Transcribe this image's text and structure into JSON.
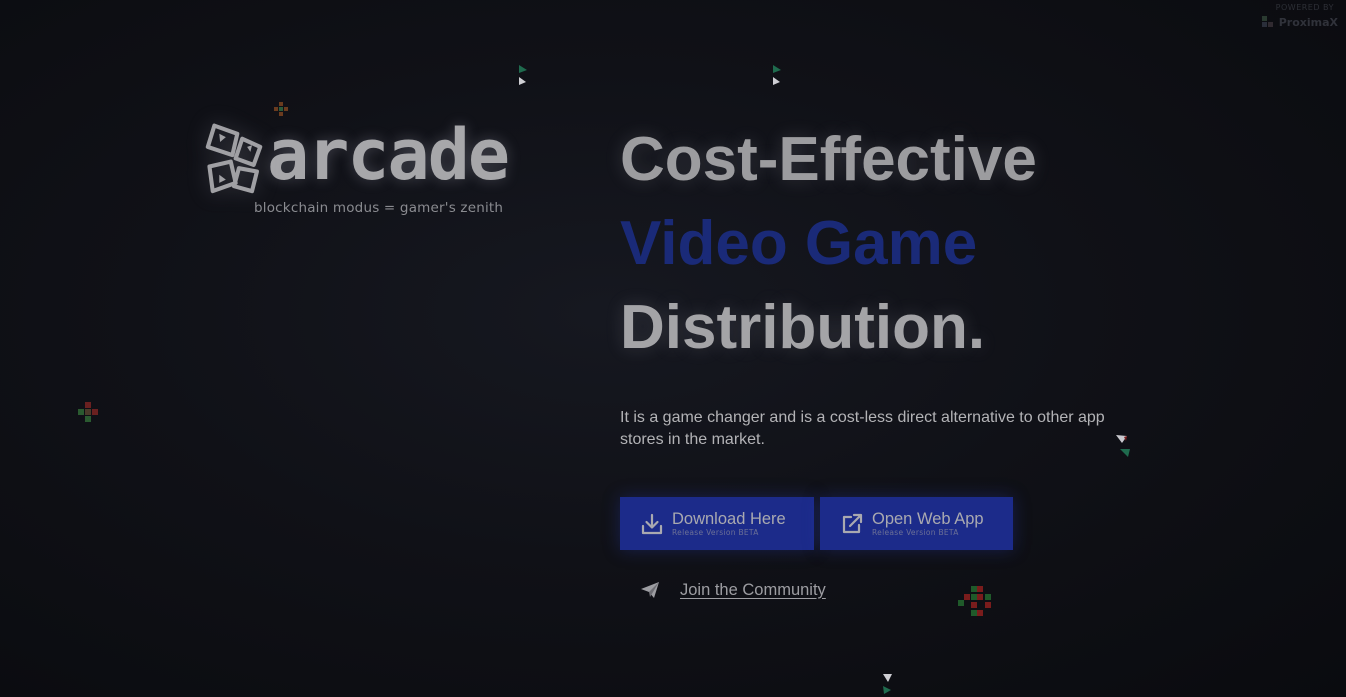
{
  "powered_by": {
    "label": "POWERED BY",
    "brand": "ProximaX"
  },
  "logo": {
    "wordmark": "arcade",
    "tagline": "blockchain modus = gamer's zenith"
  },
  "hero": {
    "line1": "Cost-Effective",
    "line2": "Video Game",
    "line3": "Distribution.",
    "description": "It is a game changer and is a cost-less direct alternative to other app stores in the market."
  },
  "buttons": {
    "download": {
      "title": "Download Here",
      "subtitle": "Release Version BETA",
      "icon": "download-icon"
    },
    "webapp": {
      "title": "Open Web App",
      "subtitle": "Release Version BETA",
      "icon": "external-link-icon"
    }
  },
  "community": {
    "label": "Join the Community",
    "icon": "send-icon"
  },
  "colors": {
    "background": "#0e0f14",
    "accent_blue": "#1c2b8a",
    "headline_blue": "#1a2a78",
    "text_gray": "#a4a4a7"
  }
}
